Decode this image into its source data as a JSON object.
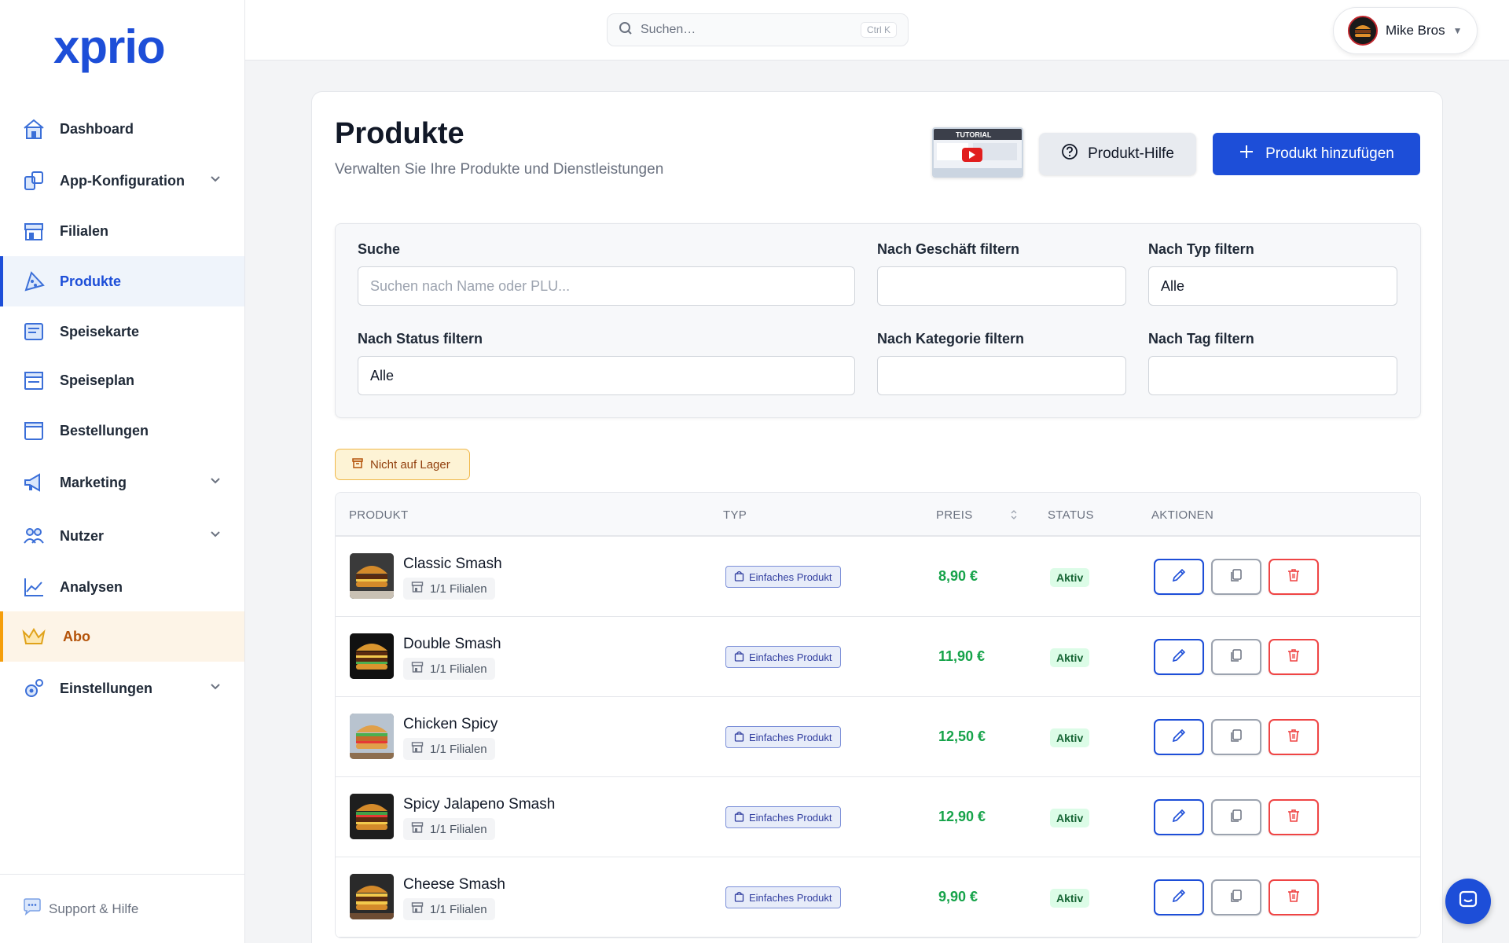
{
  "brand": {
    "logo": "xprio",
    "primary": "#1d4ed8",
    "accent": "#f59e0b",
    "success": "#16a34a",
    "danger": "#ef4444"
  },
  "sidebar": {
    "items": [
      {
        "label": "Dashboard",
        "icon": "home-icon"
      },
      {
        "label": "App-Konfiguration",
        "icon": "app-config-icon",
        "expandable": true
      },
      {
        "label": "Filialen",
        "icon": "store-icon"
      },
      {
        "label": "Produkte",
        "icon": "pizza-icon",
        "active": true
      },
      {
        "label": "Speisekarte",
        "icon": "menu-card-icon"
      },
      {
        "label": "Speiseplan",
        "icon": "meal-plan-icon"
      },
      {
        "label": "Bestellungen",
        "icon": "orders-icon"
      },
      {
        "label": "Marketing",
        "icon": "megaphone-icon",
        "expandable": true
      },
      {
        "label": "Nutzer",
        "icon": "users-icon",
        "expandable": true
      },
      {
        "label": "Analysen",
        "icon": "chart-icon"
      },
      {
        "label": "Abo",
        "icon": "crown-icon",
        "highlighted": true
      },
      {
        "label": "Einstellungen",
        "icon": "settings-icon",
        "expandable": true
      }
    ],
    "support_label": "Support & Hilfe"
  },
  "topbar": {
    "search_placeholder": "Suchen…",
    "search_shortcut": "Ctrl K",
    "user_name": "Mike Bros"
  },
  "page": {
    "title": "Produkte",
    "subtitle": "Verwalten Sie Ihre Produkte und Dienstleistungen",
    "tutorial_label": "TUTORIAL",
    "help_button": "Produkt-Hilfe",
    "add_button": "Produkt hinzufügen"
  },
  "filters": {
    "search": {
      "label": "Suche",
      "placeholder": "Suchen nach Name oder PLU..."
    },
    "store": {
      "label": "Nach Geschäft filtern",
      "value": ""
    },
    "type": {
      "label": "Nach Typ filtern",
      "value": "Alle"
    },
    "status": {
      "label": "Nach Status filtern",
      "value": "Alle"
    },
    "category": {
      "label": "Nach Kategorie filtern",
      "value": ""
    },
    "tag": {
      "label": "Nach Tag filtern",
      "value": ""
    }
  },
  "out_of_stock_label": "Nicht auf Lager",
  "table": {
    "columns": [
      "Produkt",
      "Typ",
      "Preis",
      "Status",
      "Aktionen"
    ],
    "rows": [
      {
        "name": "Classic Smash",
        "stores": "1/1 Filialen",
        "type": "Einfaches Produkt",
        "price": "8,90 €",
        "status": "Aktiv"
      },
      {
        "name": "Double Smash",
        "stores": "1/1 Filialen",
        "type": "Einfaches Produkt",
        "price": "11,90 €",
        "status": "Aktiv"
      },
      {
        "name": "Chicken Spicy",
        "stores": "1/1 Filialen",
        "type": "Einfaches Produkt",
        "price": "12,50 €",
        "status": "Aktiv"
      },
      {
        "name": "Spicy Jalapeno Smash",
        "stores": "1/1 Filialen",
        "type": "Einfaches Produkt",
        "price": "12,90 €",
        "status": "Aktiv"
      },
      {
        "name": "Cheese Smash",
        "stores": "1/1 Filialen",
        "type": "Einfaches Produkt",
        "price": "9,90 €",
        "status": "Aktiv"
      }
    ]
  }
}
